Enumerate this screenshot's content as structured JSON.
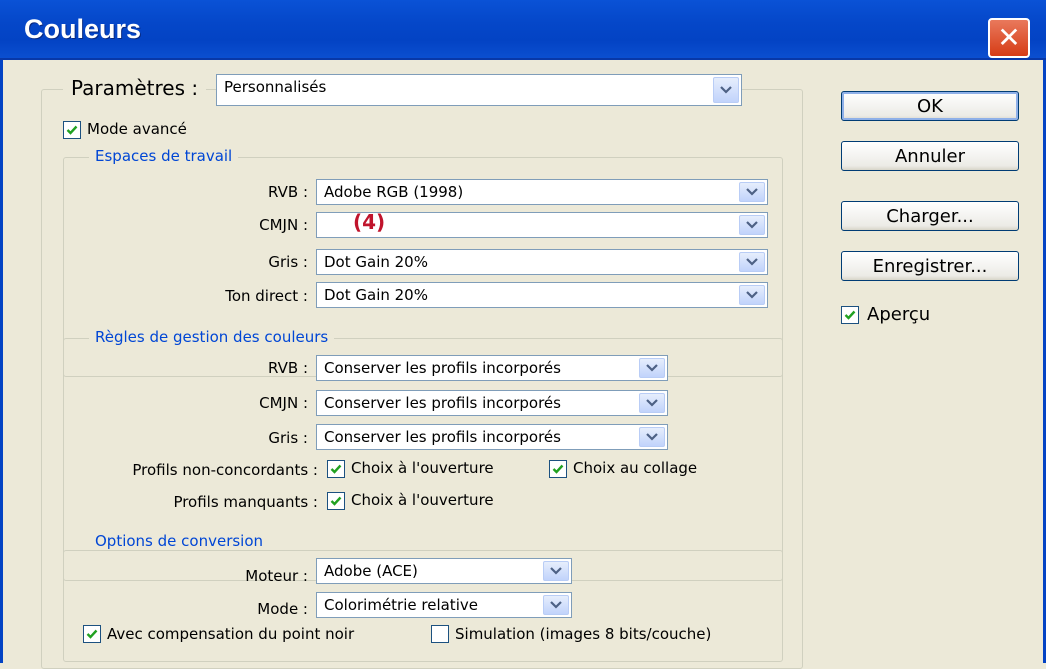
{
  "window": {
    "title": "Couleurs",
    "close_glyph": "✕"
  },
  "settings": {
    "label": "Paramètres :",
    "value": "Personnalisés"
  },
  "advanced_mode": {
    "label": "Mode avancé",
    "checked": true
  },
  "working_spaces": {
    "legend": "Espaces de travail",
    "rows": [
      {
        "label": "RVB :",
        "value": "Adobe RGB (1998)"
      },
      {
        "label": "CMJN :",
        "value": ""
      },
      {
        "label": "Gris :",
        "value": "Dot Gain 20%"
      },
      {
        "label": "Ton direct :",
        "value": "Dot Gain 20%"
      }
    ],
    "annotation": "(4)"
  },
  "color_management": {
    "legend": "Règles de gestion des couleurs",
    "rows": [
      {
        "label": "RVB :",
        "value": "Conserver les profils incorporés"
      },
      {
        "label": "CMJN :",
        "value": "Conserver les profils incorporés"
      },
      {
        "label": "Gris :",
        "value": "Conserver les profils incorporés"
      }
    ],
    "mismatch": {
      "label": "Profils non-concordants :",
      "open": {
        "label": "Choix à l'ouverture",
        "checked": true
      },
      "paste": {
        "label": "Choix au collage",
        "checked": true
      }
    },
    "missing": {
      "label": "Profils manquants :",
      "open": {
        "label": "Choix à l'ouverture",
        "checked": true
      }
    }
  },
  "conversion": {
    "legend": "Options de conversion",
    "engine": {
      "label": "Moteur :",
      "value": "Adobe (ACE)"
    },
    "intent": {
      "label": "Mode :",
      "value": "Colorimétrie relative"
    },
    "black_point": {
      "label": "Avec compensation du point noir",
      "checked": true
    },
    "simulation": {
      "label": "Simulation (images 8 bits/couche)",
      "checked": false
    }
  },
  "buttons": {
    "ok": "OK",
    "cancel": "Annuler",
    "load": "Charger...",
    "save": "Enregistrer..."
  },
  "preview": {
    "label": "Aperçu",
    "checked": true
  },
  "colors": {
    "titlebar": "#0343c4",
    "legend_text": "#0046d5",
    "dialog_bg": "#ece9d8",
    "close_button": "#d63c16",
    "annotation": "#c0142c"
  }
}
